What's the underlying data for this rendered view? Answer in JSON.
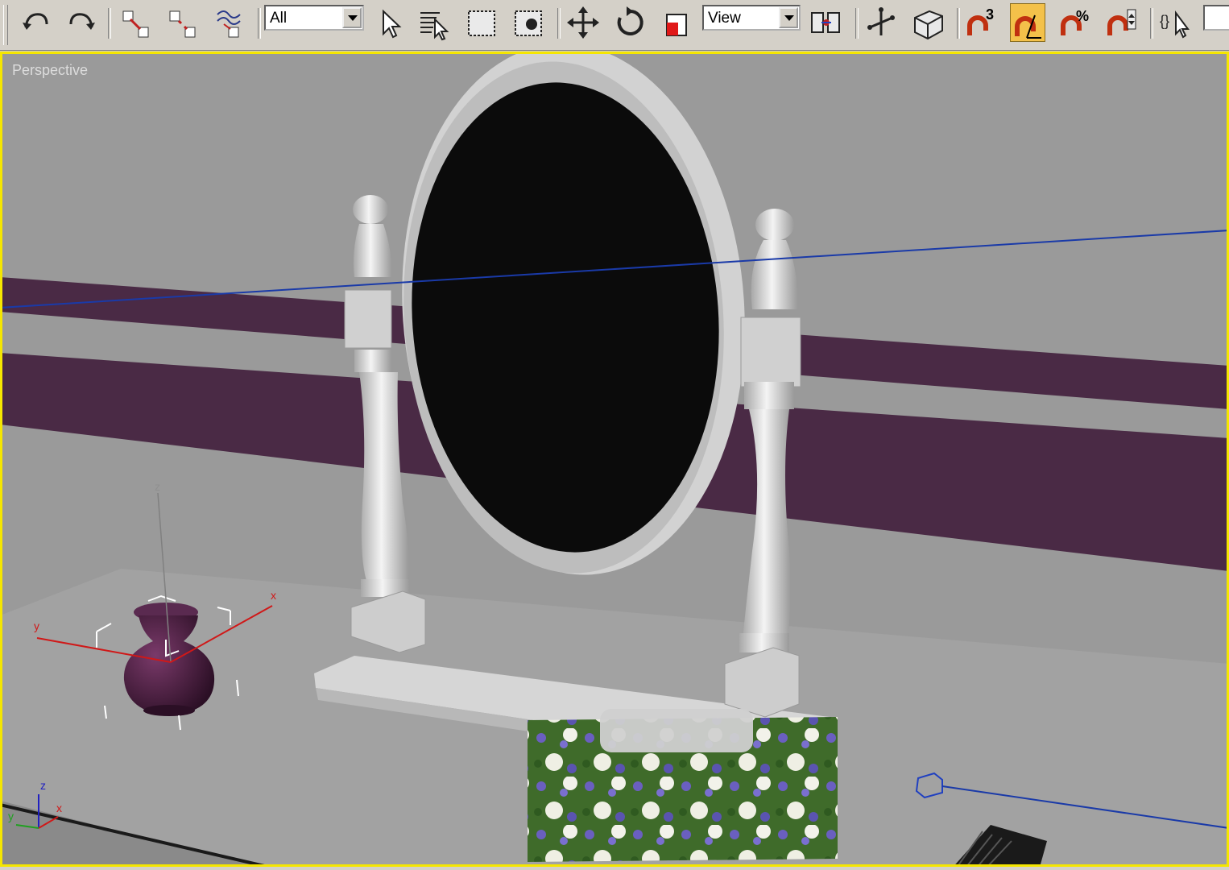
{
  "toolbar": {
    "selection_filter": {
      "value": "All"
    },
    "reference_coord_system": {
      "value": "View"
    }
  },
  "viewport": {
    "label": "Perspective",
    "border_color": "#f5e600"
  },
  "gizmo": {
    "x_label": "x",
    "y_label": "y",
    "z_label": "z"
  },
  "corner_axis": {
    "x_label": "x",
    "y_label": "y",
    "z_label": "z"
  },
  "icons": [
    "undo-icon",
    "redo-icon",
    "select-and-link-icon",
    "unlink-selection-icon",
    "bind-to-space-warp-icon",
    "select-object-icon",
    "select-by-name-icon",
    "rectangular-selection-region-icon",
    "window-crossing-icon",
    "select-and-move-icon",
    "select-and-rotate-icon",
    "select-and-scale-icon",
    "use-pivot-center-icon",
    "select-and-manipulate-icon",
    "keyboard-shortcut-override-icon",
    "snaps-toggle-icon",
    "angle-snap-toggle-icon",
    "percent-snap-toggle-icon",
    "spinner-snap-toggle-icon",
    "edit-named-selection-sets-icon"
  ],
  "colors": {
    "wall_stripe": "#4a2a45",
    "wall": "#9a9a9a",
    "mirror_glass": "#0b0b0b",
    "vase": "#4a1f3f",
    "active_button": "#f3c14a"
  }
}
